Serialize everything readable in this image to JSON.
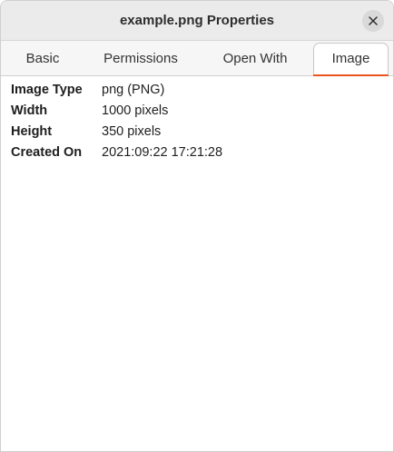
{
  "window": {
    "title": "example.png Properties",
    "close_icon": "close-icon"
  },
  "tabs": [
    {
      "label": "Basic",
      "active": false
    },
    {
      "label": "Permissions",
      "active": false
    },
    {
      "label": "Open With",
      "active": false
    },
    {
      "label": "Image",
      "active": true
    }
  ],
  "colors": {
    "accent": "#e95420",
    "titlebar_bg": "#ebebeb"
  },
  "properties": [
    {
      "label": "Image Type",
      "value": "png (PNG)"
    },
    {
      "label": "Width",
      "value": "1000 pixels"
    },
    {
      "label": "Height",
      "value": "350 pixels"
    },
    {
      "label": "Created On",
      "value": "2021:09:22 17:21:28"
    }
  ]
}
